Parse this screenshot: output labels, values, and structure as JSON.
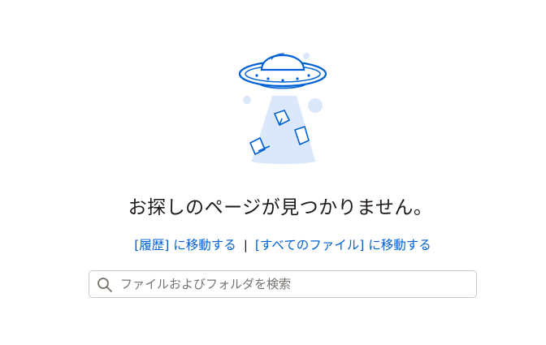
{
  "illustration": {
    "icon": "ufo-icon",
    "stroke_color": "#0061d5",
    "beam_color": "#dbe8fb"
  },
  "message": {
    "headline": "お探しのページが見つかりません。"
  },
  "links": {
    "history_label": "[履歴]",
    "go_text_1": " に移動する",
    "separator": "|",
    "all_files_label": "[すべてのファイル]",
    "go_text_2": " に移動する",
    "link_color": "#0061d5"
  },
  "search": {
    "placeholder": "ファイルおよびフォルダを検索",
    "value": "",
    "icon": "search-icon"
  }
}
